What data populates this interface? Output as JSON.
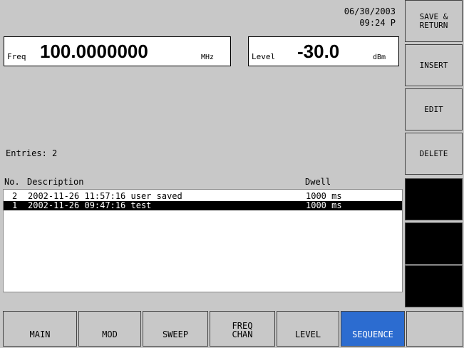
{
  "header": {
    "date": "06/30/2003",
    "time": "09:24 P"
  },
  "freq": {
    "label": "Freq",
    "value": "100.0000000",
    "unit": "MHz"
  },
  "level": {
    "label": "Level",
    "value": "-30.0",
    "unit": "dBm"
  },
  "list": {
    "entries_label": "Entries: 2",
    "columns": {
      "no": "No.",
      "description": "Description",
      "dwell": "Dwell"
    },
    "rows": [
      {
        "no": "2",
        "description": "2002-11-26 11:57:16 user saved",
        "dwell": "1000 ms",
        "selected": false
      },
      {
        "no": "1",
        "description": "2002-11-26 09:47:16 test",
        "dwell": "1000 ms",
        "selected": true
      }
    ]
  },
  "softkeys": [
    "SAVE &\nRETURN",
    "INSERT",
    "EDIT",
    "DELETE",
    "",
    "",
    ""
  ],
  "tabs": [
    {
      "label": "MAIN",
      "active": false
    },
    {
      "label": "MOD",
      "active": false
    },
    {
      "label": "SWEEP",
      "active": false
    },
    {
      "label": "FREQ\nCHAN",
      "active": false
    },
    {
      "label": "LEVEL",
      "active": false
    },
    {
      "label": "SEQUENCE",
      "active": true
    },
    {
      "label": "",
      "active": false
    }
  ],
  "colors": {
    "background": "#c8c8c8",
    "active_tab": "#2c6cd0",
    "selection": "#000000"
  }
}
